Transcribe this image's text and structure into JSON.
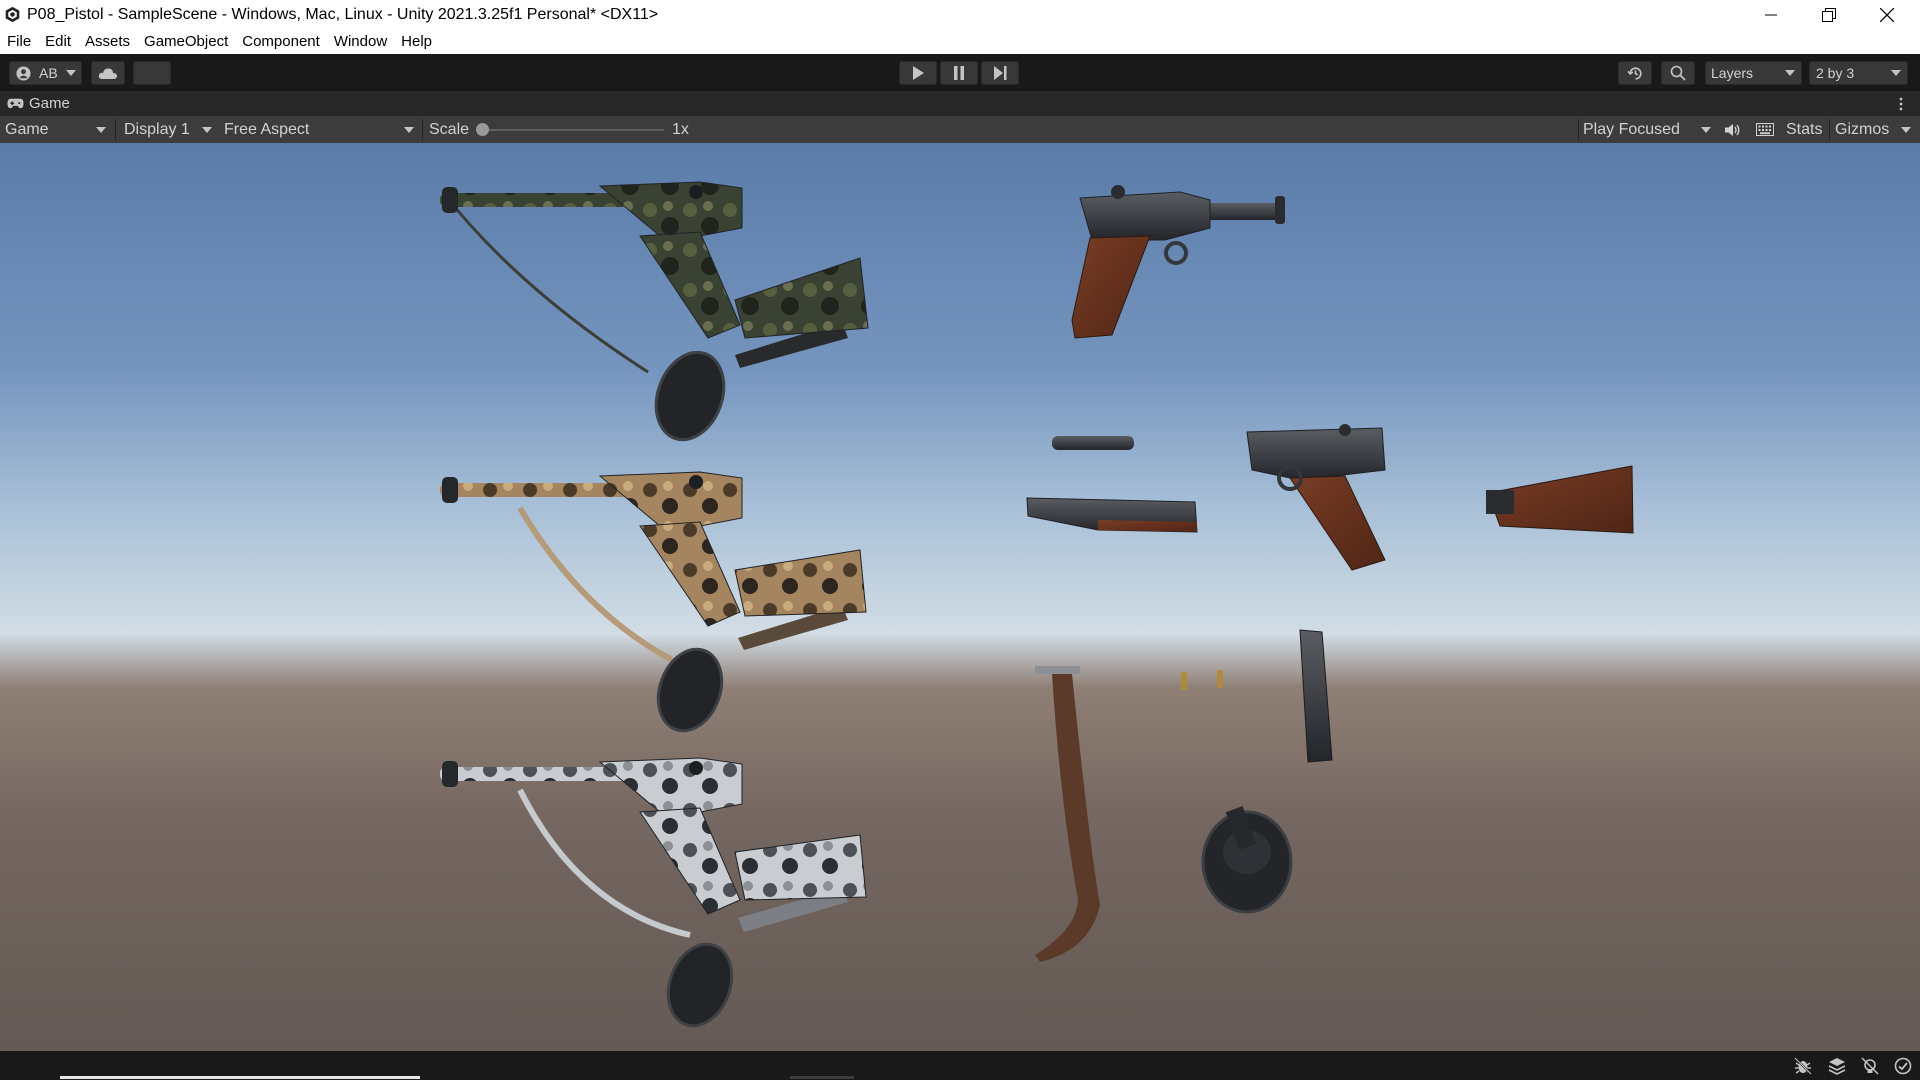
{
  "window": {
    "title": "P08_Pistol - SampleScene - Windows, Mac, Linux - Unity 2021.3.25f1 Personal* <DX11>",
    "app_icon": "unity-logo-icon"
  },
  "menu": [
    "File",
    "Edit",
    "Assets",
    "GameObject",
    "Component",
    "Window",
    "Help"
  ],
  "toolbar": {
    "account_label": "AB",
    "layers_label": "Layers",
    "layout_label": "2 by 3",
    "icons": [
      "account-icon",
      "cloud-icon",
      "play-icon",
      "pause-icon",
      "step-icon",
      "history-icon",
      "search-icon"
    ]
  },
  "tab": {
    "label": "Game"
  },
  "gamebar": {
    "view_mode": "Game",
    "display": "Display 1",
    "aspect": "Free Aspect",
    "scale_label": "Scale",
    "scale_value": "1x",
    "scale_fraction": 0.0,
    "play_mode": "Play Focused",
    "stats_label": "Stats",
    "gizmos_label": "Gizmos"
  },
  "scene": {
    "objects": [
      "pistol-green-camo",
      "pistol-tan-camo",
      "pistol-snow-camo",
      "pistol-assembled",
      "barrel-short",
      "barrel-long",
      "pistol-frame",
      "wooden-stock",
      "sling-strap",
      "bullet-1",
      "bullet-2",
      "magazine",
      "drum-magazine"
    ]
  },
  "colors": {
    "toolbar_bg": "#191919",
    "gamebar_bg": "#3c3c3c",
    "sky_top": "#5a7ca8",
    "horizon": "#d2dde5",
    "ground": "#655a55"
  }
}
